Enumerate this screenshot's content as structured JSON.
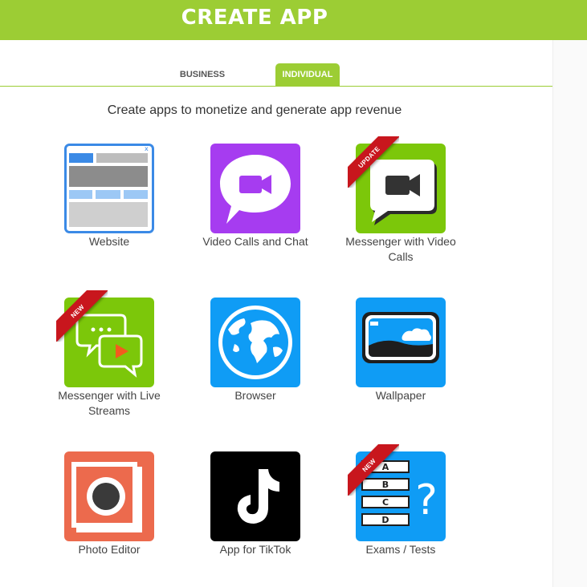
{
  "header": {
    "title": "CREATE APP"
  },
  "tabs": [
    {
      "label": "BUSINESS",
      "active": false
    },
    {
      "label": "INDIVIDUAL",
      "active": true
    }
  ],
  "subtitle": "Create apps to monetize and generate app revenue",
  "apps": [
    {
      "label": "Website",
      "icon": "website-icon",
      "badge": ""
    },
    {
      "label": "Video Calls and Chat",
      "icon": "video-chat-icon",
      "badge": ""
    },
    {
      "label": "Messenger with Video Calls",
      "icon": "messenger-video-icon",
      "badge": "UPDATE"
    },
    {
      "label": "Messenger with Live Streams",
      "icon": "messenger-stream-icon",
      "badge": "NEW"
    },
    {
      "label": "Browser",
      "icon": "globe-icon",
      "badge": ""
    },
    {
      "label": "Wallpaper",
      "icon": "wallpaper-icon",
      "badge": ""
    },
    {
      "label": "Photo Editor",
      "icon": "photo-editor-icon",
      "badge": ""
    },
    {
      "label": "App for TikTok",
      "icon": "tiktok-icon",
      "badge": ""
    },
    {
      "label": "Exams / Tests",
      "icon": "exam-icon",
      "badge": "NEW",
      "quiz_letters": [
        "A",
        "B",
        "C",
        "D"
      ],
      "quiz_symbol": "?"
    }
  ],
  "colors": {
    "brand": "#9ccd34",
    "ribbon": "#c8161d",
    "purple": "#a63cf0",
    "green": "#7cc70a",
    "blue": "#0f9cf5"
  }
}
